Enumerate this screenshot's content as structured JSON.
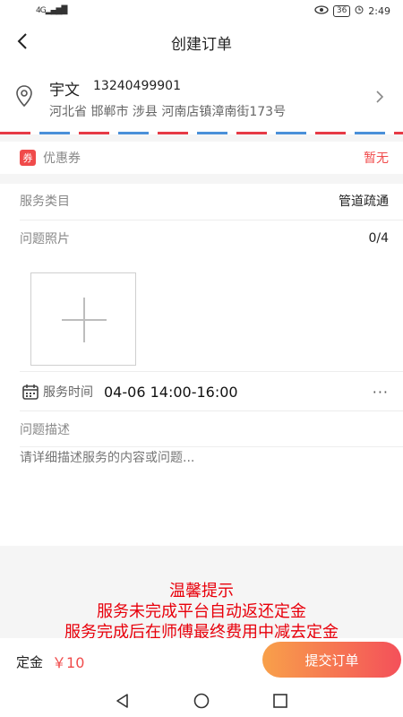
{
  "status_bar": {
    "signal": "4G",
    "battery": "36",
    "time": "2:49"
  },
  "nav": {
    "title": "创建订单"
  },
  "address": {
    "name": "宇文",
    "phone": "13240499901",
    "detail": "河北省 邯郸市 涉县 河南店镇漳南街173号"
  },
  "coupon": {
    "badge": "券",
    "label": "优惠券",
    "value": "暂无"
  },
  "form": {
    "service_category_label": "服务类目",
    "service_category_value": "管道疏通",
    "photos_label": "问题照片",
    "photos_count": "0/4",
    "service_time_label": "服务时间",
    "service_time_value": "04-06 14:00-16:00",
    "description_label": "问题描述",
    "description_placeholder": "请详细描述服务的内容或问题..."
  },
  "tips": {
    "title": "温馨提示",
    "line1": "服务未完成平台自动返还定金",
    "line2": "服务完成后在师傅最终费用中减去定金"
  },
  "footer": {
    "deposit_label": "定金",
    "deposit_amount": "￥10",
    "submit_label": "提交订单"
  },
  "colors": {
    "accent": "#f04b4b",
    "tip_red": "#e8000b"
  }
}
